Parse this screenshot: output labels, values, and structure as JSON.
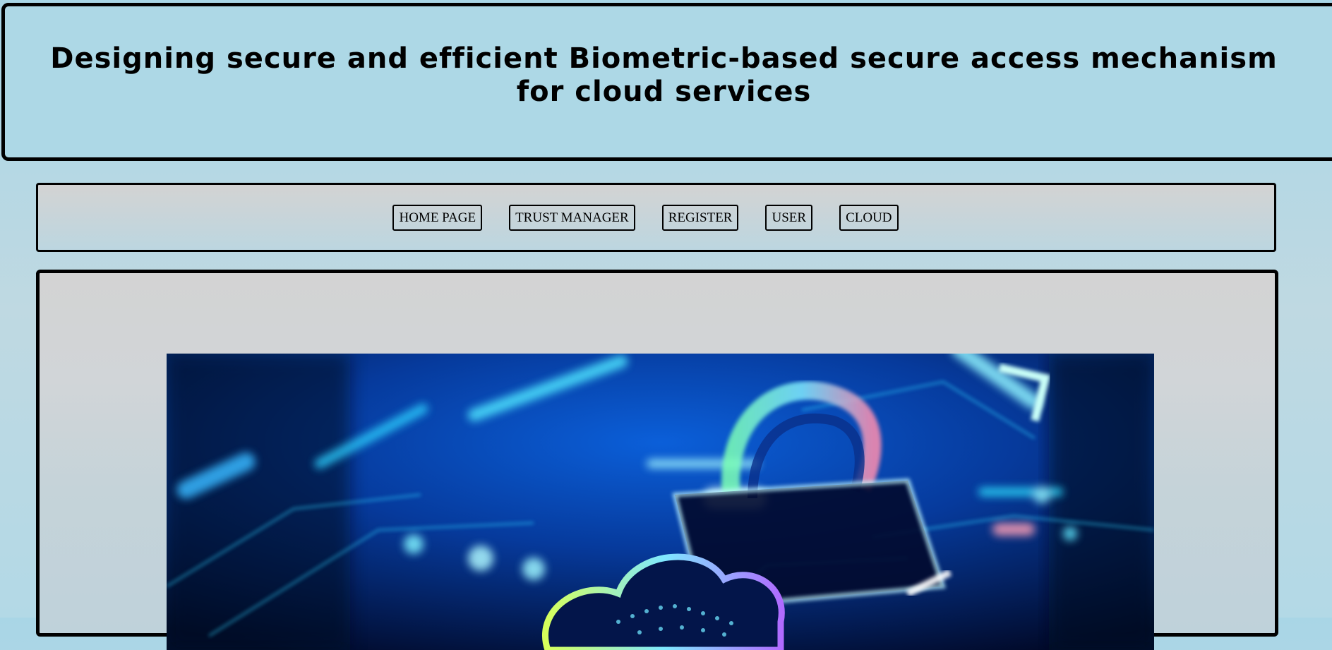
{
  "header": {
    "title": "Designing secure and efficient Biometric-based secure access mechanism for cloud services"
  },
  "nav": {
    "items": [
      {
        "label": "HOME PAGE"
      },
      {
        "label": "TRUST MANAGER"
      },
      {
        "label": "REGISTER"
      },
      {
        "label": "USER"
      },
      {
        "label": "CLOUD"
      }
    ]
  },
  "hero": {
    "icon": "cloud-lock-icon",
    "colors": {
      "base": "#02103a",
      "glow_cyan": "#2fe0ff",
      "glow_blue": "#0a4fd6",
      "glow_green": "#7dffb5",
      "glow_pink": "#ff8fb0"
    }
  }
}
